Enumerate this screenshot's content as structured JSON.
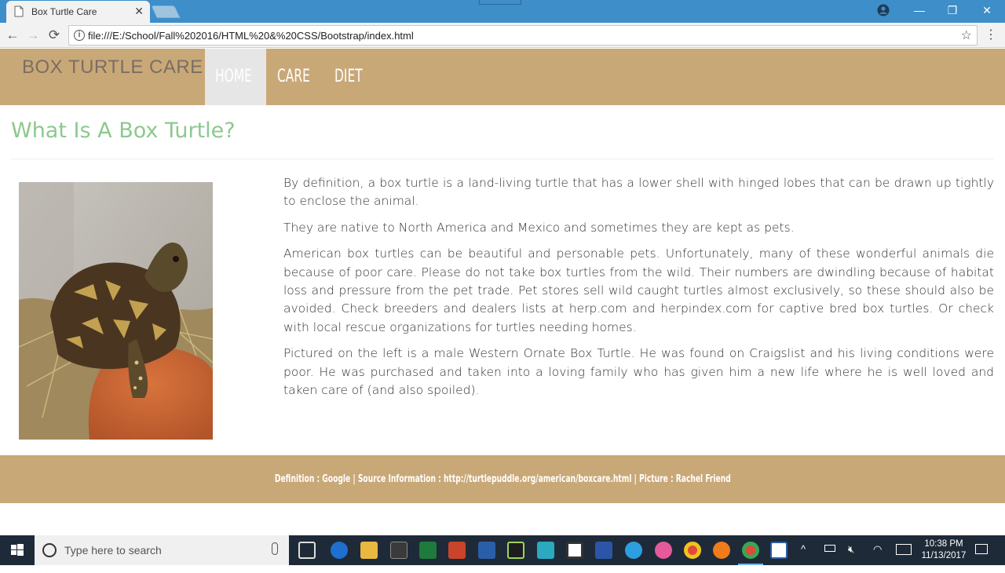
{
  "browser": {
    "tab_title": "Box Turtle Care",
    "tab_close": "✕",
    "url": "file:///E:/School/Fall%202016/HTML%20&%20CSS/Bootstrap/index.html",
    "back": "←",
    "forward": "→",
    "reload": "⟳",
    "star": "☆",
    "menu": "⋮",
    "minimize": "—",
    "restore": "❐",
    "close": "✕"
  },
  "site": {
    "brand": "BOX TURTLE CARE",
    "nav": [
      "HOME",
      "CARE",
      "DIET"
    ],
    "active_nav": "HOME",
    "colors": {
      "nav_bg": "#c9a878",
      "title": "#8cc98e",
      "active_bg": "#e6e6e6"
    }
  },
  "main": {
    "title": "What Is A Box Turtle?",
    "paragraphs": [
      "By definition, a box turtle is a land-living turtle that has a lower shell with hinged lobes that can be drawn up tightly to enclose the animal.",
      "They are native to North America and Mexico and sometimes they are kept as pets.",
      "American box turtles can be beautiful and personable pets. Unfortunately, many of these wonderful animals die because of poor care. Please do not take box turtles from the wild. Their numbers are dwindling because of habitat loss and pressure from the pet trade. Pet stores sell wild caught turtles almost exclusively, so these should also be avoided. Check breeders and dealers lists at herp.com and herpindex.com for captive bred box turtles. Or check with local rescue organizations for turtles needing homes.",
      "Pictured on the left is a male Western Ornate Box Turtle. He was found on Craigslist and his living conditions were poor. He was purchased and taken into a loving family who has given him a new life where he is well loved and taken care of (and also spoiled)."
    ]
  },
  "footer": {
    "text": "Definition : Google | Source Information : http://turtlepuddle.org/american/boxcare.html | Picture : Rachel Friend"
  },
  "taskbar": {
    "search_placeholder": "Type here to search",
    "time": "10:38 PM",
    "date": "11/13/2017"
  }
}
